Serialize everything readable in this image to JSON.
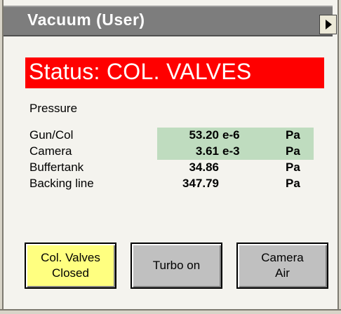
{
  "window": {
    "title": "Vacuum (User)",
    "menu_arrow_icon": "triangle-right-icon"
  },
  "status": {
    "text": "Status:  COL. VALVES",
    "color": "#ff0000"
  },
  "pressure": {
    "label": "Pressure",
    "rows": [
      {
        "name": "Gun/Col",
        "value": "53.20",
        "exponent": "e-6",
        "unit": "Pa",
        "highlighted": true
      },
      {
        "name": "Camera",
        "value": "3.61",
        "exponent": "e-3",
        "unit": "Pa",
        "highlighted": true
      },
      {
        "name": "Buffertank",
        "value": "34.86",
        "exponent": "",
        "unit": "Pa",
        "highlighted": false
      },
      {
        "name": "Backing line",
        "value": "347.79",
        "exponent": "",
        "unit": "Pa",
        "highlighted": false
      }
    ],
    "highlight_color": "#bfdcbf"
  },
  "buttons": [
    {
      "label": "Col. Valves\nClosed",
      "color": "#ffff80"
    },
    {
      "label": "Turbo on",
      "color": "#c0c0c0"
    },
    {
      "label": "Camera\nAir",
      "color": "#c0c0c0"
    }
  ]
}
